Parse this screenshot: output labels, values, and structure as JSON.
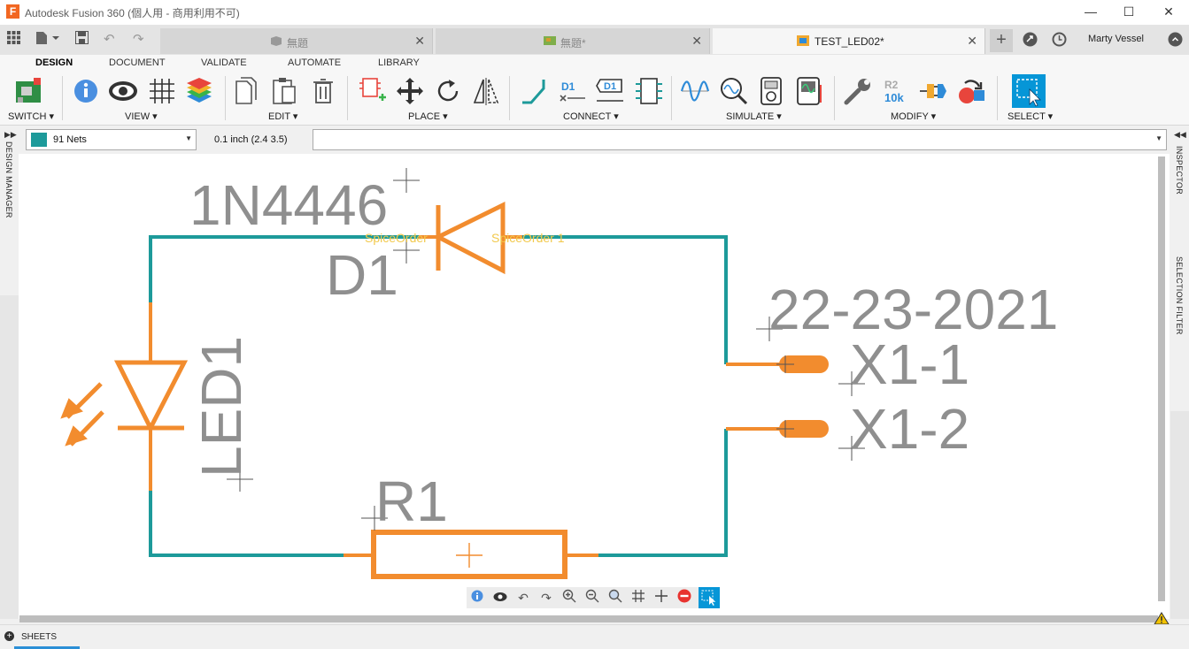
{
  "window": {
    "title": "Autodesk Fusion 360 (個人用 - 商用利用不可)",
    "app_icon": "F",
    "minimize_icon": "minimize-icon",
    "maximize_icon": "maximize-icon",
    "close_icon": "close-icon"
  },
  "tabs": [
    {
      "label": "無題",
      "icon": "3d-box-icon",
      "active": false
    },
    {
      "label": "無題*",
      "icon": "pcb-board-icon",
      "active": false
    },
    {
      "label": "TEST_LED02*",
      "icon": "schematic-icon",
      "active": true
    }
  ],
  "user": {
    "name": "Marty Vessel"
  },
  "ribbon": {
    "tabs": [
      "DESIGN",
      "DOCUMENT",
      "VALIDATE",
      "AUTOMATE",
      "LIBRARY"
    ],
    "active_tab": "DESIGN",
    "groups": {
      "switch": "SWITCH",
      "view": "VIEW",
      "edit": "EDIT",
      "place": "PLACE",
      "connect": "CONNECT",
      "simulate": "SIMULATE",
      "modify": "MODIFY",
      "select": "SELECT"
    },
    "modify_text": {
      "r2": "R2",
      "r2_value": "10k"
    },
    "connect_text": {
      "d1": "D1"
    }
  },
  "command_row": {
    "net_selector": "91 Nets",
    "net_color": "#1d9a9a",
    "grid": "0.1 inch (2.4 3.5)",
    "command_value": ""
  },
  "side_panels": {
    "left": "DESIGN MANAGER",
    "right_top": "INSPECTOR",
    "right_bottom": "SELECTION FILTER"
  },
  "schematic": {
    "diode_value": "1N4446",
    "diode_name": "D1",
    "spice_left": "SpiceOrder",
    "spice_right": "SpiceOrder 1",
    "led_name": "LED1",
    "resistor_name": "R1",
    "connector_value": "22-23-2021",
    "pin1": "X1-1",
    "pin2": "X1-2",
    "wire_color": "#1d9a9a",
    "part_color": "#f28c2e",
    "text_color": "#8f8f8f",
    "spice_color": "#f2c94c"
  },
  "bottom": {
    "sheets": "SHEETS"
  },
  "colors": {
    "accent": "#0696d7",
    "warning": "#f2c200"
  }
}
